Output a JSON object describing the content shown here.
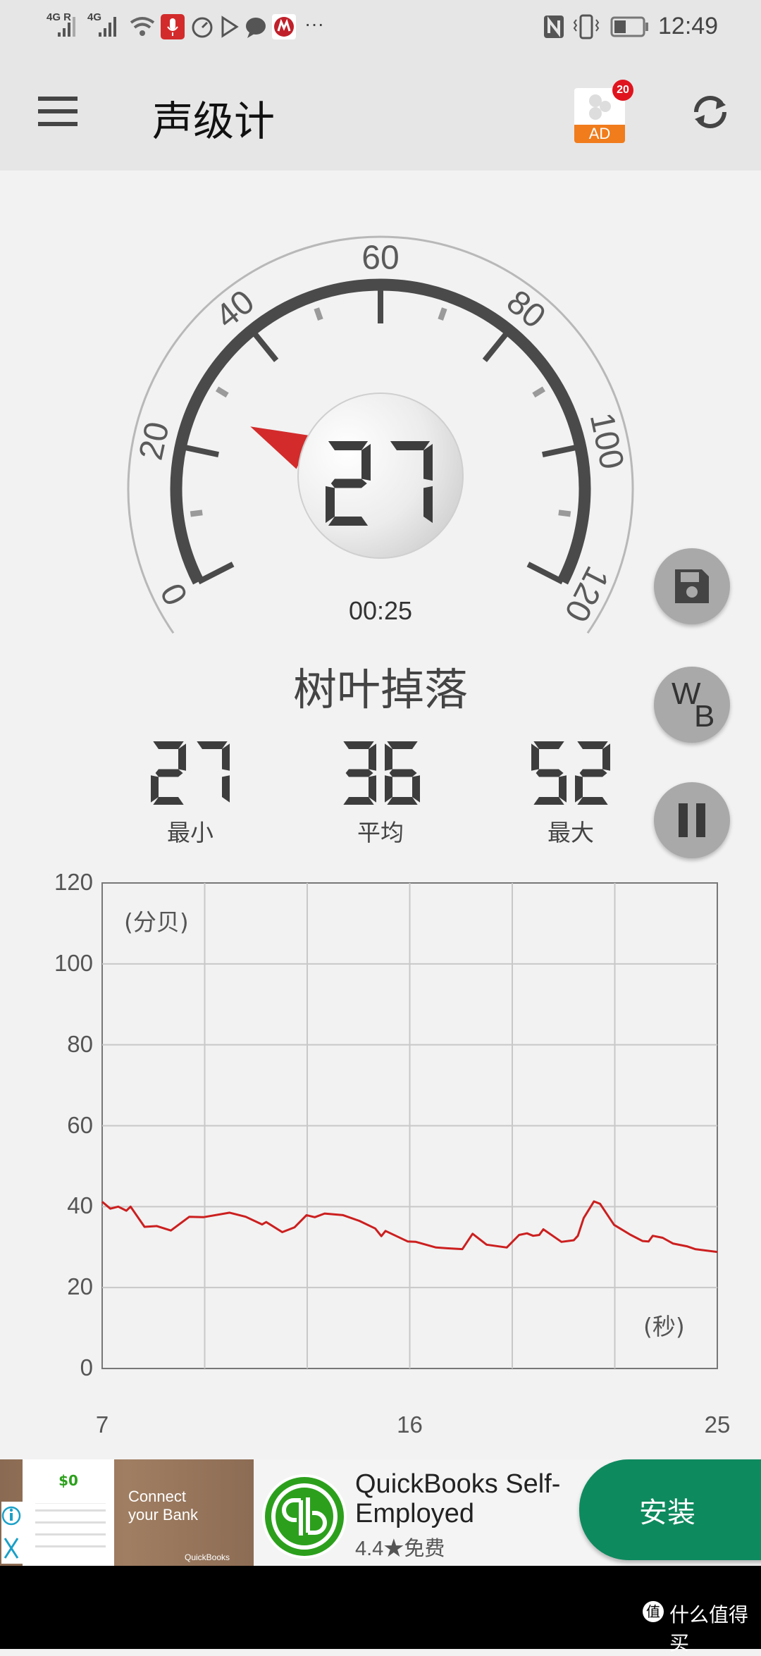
{
  "status_bar": {
    "signal1": "4G R",
    "signal2": "4G",
    "more": "···",
    "time": "12:49",
    "icons": [
      "signal-icon",
      "signal-icon",
      "wifi-icon",
      "microphone-icon",
      "speedometer-icon",
      "play-store-icon",
      "chat-icon",
      "bank-app-icon",
      "nfc-icon",
      "vibrate-icon",
      "battery-icon"
    ]
  },
  "toolbar": {
    "title": "声级计",
    "menu_icon": "hamburger-menu-icon",
    "ad_label": "AD",
    "ad_badge": "20",
    "refresh_icon": "refresh-icon",
    "ad_color": "#f07c1c",
    "badge_color": "#e0141e"
  },
  "gauge": {
    "value": "27",
    "min": 0,
    "max": 120,
    "tick_labels": [
      "0",
      "20",
      "40",
      "60",
      "80",
      "100",
      "120"
    ],
    "needle_color": "#d32b2b",
    "elapsed": "00:25",
    "description": "树叶掉落"
  },
  "stats": [
    {
      "value": "27",
      "label": "最小"
    },
    {
      "value": "36",
      "label": "平均"
    },
    {
      "value": "52",
      "label": "最大"
    }
  ],
  "side_buttons": {
    "save_icon": "floppy-save-icon",
    "wb_w": "W",
    "wb_b": "B",
    "pause_icon": "pause-icon"
  },
  "chart_data": {
    "type": "line",
    "ylabel": "(分贝)",
    "xlabel": "(秒)",
    "ylim": [
      0,
      120
    ],
    "xlim": [
      7,
      25
    ],
    "yticks": [
      "0",
      "20",
      "40",
      "60",
      "80",
      "100",
      "120"
    ],
    "xticks": [
      "7",
      "16",
      "25"
    ],
    "grid": true,
    "line_color": "#cc1f1f",
    "x": [
      7.0,
      7.24,
      7.47,
      7.71,
      7.83,
      8.24,
      8.6,
      9.01,
      9.55,
      9.96,
      10.73,
      11.2,
      11.68,
      11.8,
      12.27,
      12.63,
      12.98,
      13.22,
      13.51,
      14.05,
      14.52,
      14.99,
      15.17,
      15.29,
      15.94,
      16.18,
      16.77,
      17.13,
      17.54,
      17.84,
      18.25,
      18.84,
      19.2,
      19.43,
      19.61,
      19.79,
      19.91,
      20.44,
      20.8,
      20.92,
      21.09,
      21.39,
      21.57,
      21.98,
      22.45,
      22.81,
      22.99,
      23.11,
      23.4,
      23.7,
      24.11,
      24.35,
      25.0
    ],
    "y": [
      41.2,
      39.5,
      40,
      39,
      40,
      35,
      35.2,
      34.1,
      37.5,
      37.4,
      38.5,
      37.5,
      35.6,
      36.2,
      33.7,
      34.9,
      37.9,
      37.4,
      38.3,
      37.9,
      36.5,
      34.6,
      32.7,
      34,
      31.4,
      31.3,
      29.9,
      29.7,
      29.5,
      33.3,
      30.6,
      29.9,
      33,
      33.4,
      32.8,
      33,
      34.4,
      31.3,
      31.7,
      32.8,
      37.2,
      41.3,
      40.7,
      35.5,
      33.1,
      31.5,
      31.4,
      32.8,
      32.3,
      30.9,
      30.2,
      29.5,
      28.8
    ]
  },
  "ad": {
    "image_text": "Connect your Bank",
    "image_brand": "QuickBooks",
    "app_name_line1": "QuickBooks Self-",
    "app_name_line2": "Employed",
    "rating": "4.4",
    "star": "★",
    "price": "免费",
    "install": "安装",
    "install_color": "#0e8a5f",
    "info_icon": "info-icon",
    "close_icon": "close-icon"
  },
  "watermark": "什么值得买"
}
